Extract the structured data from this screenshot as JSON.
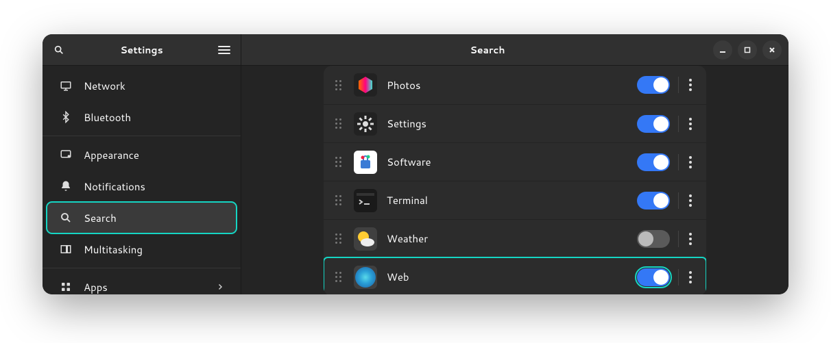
{
  "sidebar": {
    "title": "Settings",
    "items": [
      {
        "label": "Network",
        "icon": "network-icon"
      },
      {
        "label": "Bluetooth",
        "icon": "bluetooth-icon"
      },
      {
        "sep": true
      },
      {
        "label": "Appearance",
        "icon": "monitor-icon"
      },
      {
        "label": "Notifications",
        "icon": "bell-icon"
      },
      {
        "label": "Search",
        "icon": "search-icon",
        "active": true,
        "highlight": true
      },
      {
        "label": "Multitasking",
        "icon": "multitask-icon"
      },
      {
        "sep": true
      },
      {
        "label": "Apps",
        "icon": "grid-icon",
        "chevron": true
      }
    ]
  },
  "page": {
    "title": "Search",
    "rows": [
      {
        "label": "Photos",
        "icon": "photos-icon",
        "on": true
      },
      {
        "label": "Settings",
        "icon": "settings-gear-icon",
        "on": true
      },
      {
        "label": "Software",
        "icon": "software-icon",
        "on": true
      },
      {
        "label": "Terminal",
        "icon": "terminal-icon",
        "on": true
      },
      {
        "label": "Weather",
        "icon": "weather-icon",
        "on": false
      },
      {
        "label": "Web",
        "icon": "web-icon",
        "on": true,
        "highlight_row": true,
        "highlight_toggle": true
      }
    ]
  }
}
